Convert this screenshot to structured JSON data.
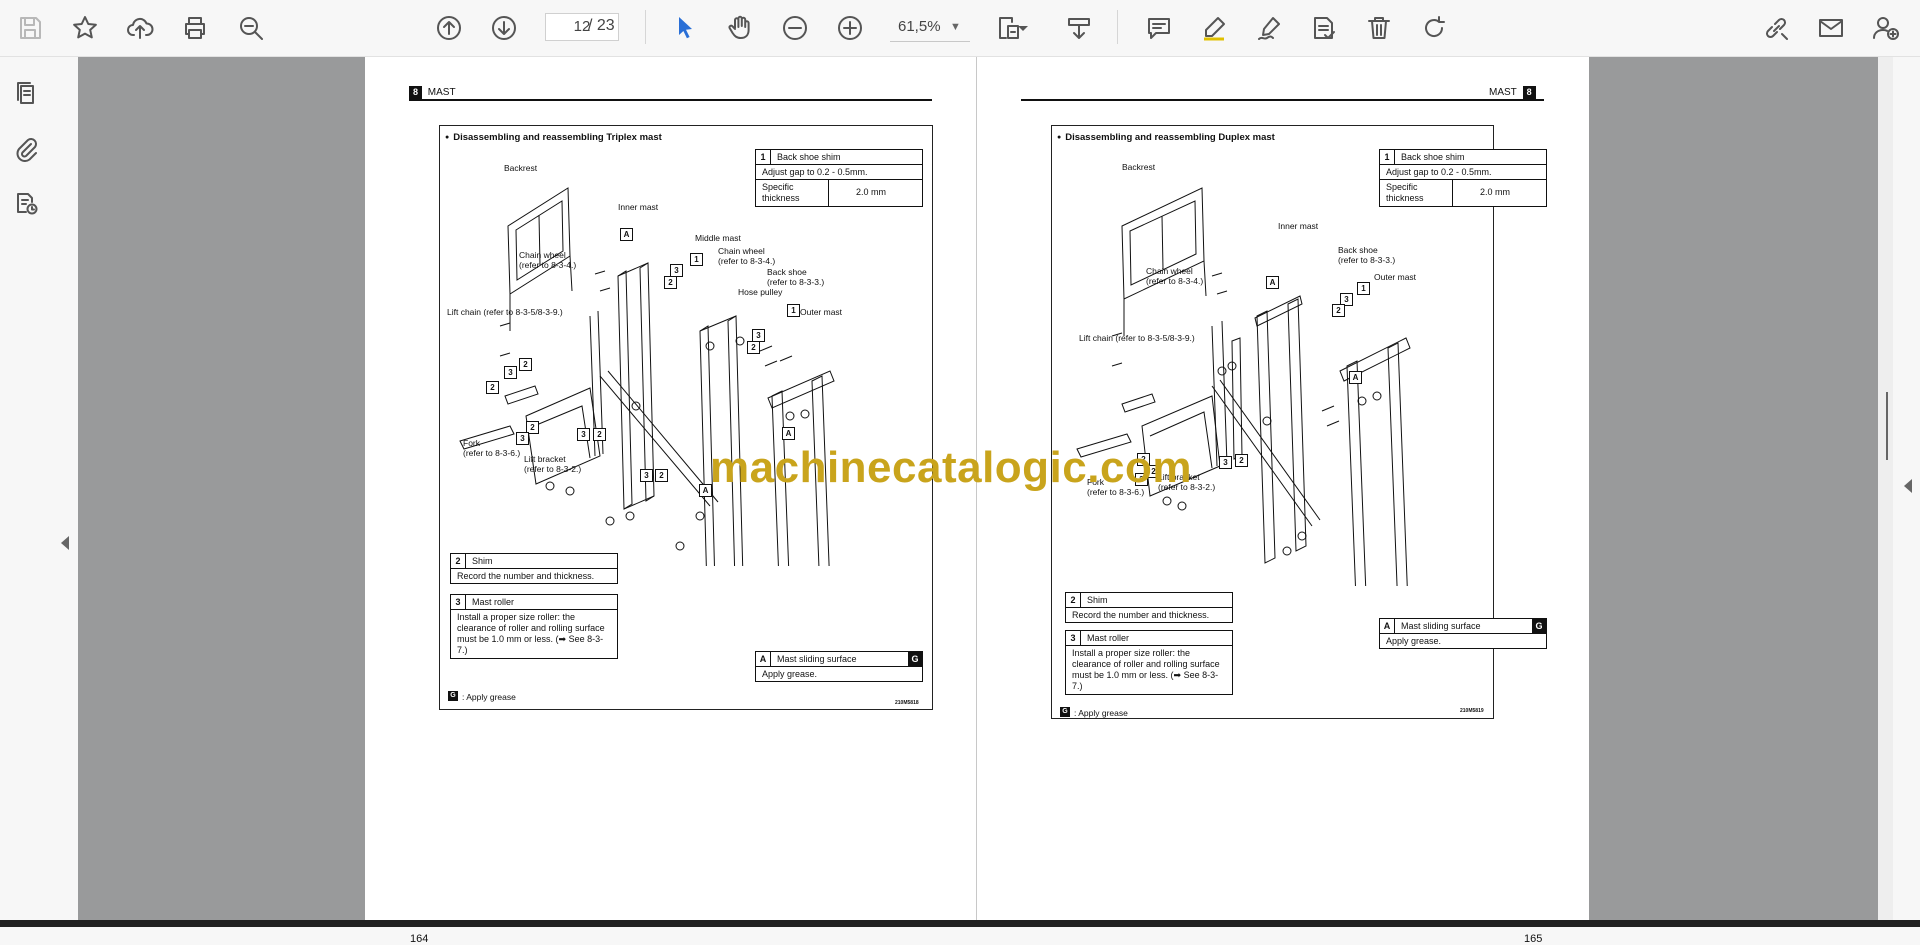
{
  "toolbar": {
    "page_current": "12",
    "page_total": "/ 23",
    "zoom": "61,5%",
    "icons": [
      "save-icon",
      "bookmark-star-icon",
      "upload-cloud-icon",
      "print-icon",
      "zoom-search-icon",
      "page-up-icon",
      "page-down-icon",
      "select-cursor-icon",
      "hand-pan-icon",
      "zoom-out-icon",
      "zoom-in-icon",
      "fit-page-icon",
      "scroll-mode-icon",
      "comment-icon",
      "highlight-pen-icon",
      "draw-signature-icon",
      "stamp-icon",
      "delete-trash-icon",
      "rotate-icon",
      "share-link-icon",
      "mail-icon",
      "add-user-icon"
    ]
  },
  "sidebar": {
    "icons": [
      "page-thumbnails-icon",
      "attachment-icon",
      "page-layers-icon"
    ]
  },
  "watermark": "machinecatalogic.com",
  "page_left": {
    "section_num": "8",
    "section_title": "MAST",
    "figure_title": "Disassembling and reassembling Triplex mast",
    "page_number": "164",
    "figure_id": "210M5818",
    "back_shoe_table": {
      "key": "1",
      "title": "Back shoe shim",
      "note": "Adjust gap to 0.2 - 0.5mm.",
      "spec_label": "Specific thickness",
      "spec_value": "2.0 mm"
    },
    "shim_table": {
      "key": "2",
      "title": "Shim",
      "note": "Record the number and thickness."
    },
    "roller_table": {
      "key": "3",
      "title": "Mast roller",
      "note": "Install a proper size roller: the clearance of roller and rolling surface must be 1.0 mm or less. (➡ See 8-3-7.)"
    },
    "sliding_table": {
      "key": "A",
      "title": "Mast sliding surface",
      "badge": "G",
      "note": "Apply grease."
    },
    "legend": {
      "key": "G",
      "text": ": Apply grease"
    },
    "labels": {
      "backrest": "Backrest",
      "inner_mast": "Inner mast",
      "middle_mast": "Middle mast",
      "chain_wheel": "Chain wheel\n(refer to 8-3-4.)",
      "chain_wheel_2": "Chain wheel\n(refer to 8-3-4.)",
      "back_shoe": "Back shoe\n(refer to 8-3-3.)",
      "hose_pulley": "Hose pulley",
      "outer_mast": "Outer mast",
      "lift_chain": "Lift chain (refer to 8-3-5/8-3-9.)",
      "fork": "Fork\n(refer to 8-3-6.)",
      "lift_bracket": "Lift bracket\n(refer to 8-3-2.)"
    }
  },
  "page_right": {
    "section_num": "8",
    "section_title": "MAST",
    "figure_title": "Disassembling and reassembling Duplex mast",
    "page_number": "165",
    "figure_id": "210M5819",
    "back_shoe_table": {
      "key": "1",
      "title": "Back shoe shim",
      "note": "Adjust gap to 0.2 - 0.5mm.",
      "spec_label": "Specific thickness",
      "spec_value": "2.0 mm"
    },
    "shim_table": {
      "key": "2",
      "title": "Shim",
      "note": "Record the number and thickness."
    },
    "roller_table": {
      "key": "3",
      "title": "Mast roller",
      "note": "Install a proper size roller: the clearance of roller and rolling surface must be 1.0 mm or less. (➡ See 8-3-7.)"
    },
    "sliding_table": {
      "key": "A",
      "title": "Mast sliding surface",
      "badge": "G",
      "note": "Apply grease."
    },
    "legend": {
      "key": "G",
      "text": ": Apply grease"
    },
    "labels": {
      "backrest": "Backrest",
      "inner_mast": "Inner mast",
      "chain_wheel": "Chain wheel\n(refer to 8-3-4.)",
      "back_shoe": "Back shoe\n(refer to 8-3-3.)",
      "outer_mast": "Outer mast",
      "lift_chain": "Lift chain (refer to 8-3-5/8-3-9.)",
      "fork": "Fork\n(refer to 8-3-6.)",
      "lift_bracket": "Lift bracket\n(refer to 8-3-2.)"
    }
  }
}
